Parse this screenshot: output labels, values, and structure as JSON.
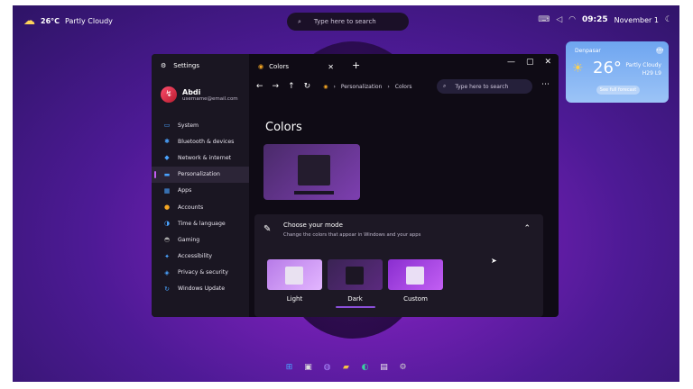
{
  "topbar": {
    "weather_temp": "26°C",
    "weather_desc": "Partly Cloudy",
    "search_placeholder": "Type here to search",
    "time": "09:25",
    "date": "November 1"
  },
  "weather_widget": {
    "location": "Denpasar",
    "temperature": "26°",
    "condition": "Partly Cloudy",
    "hi_lo": "H29 L9",
    "forecast_link": "See full forecast"
  },
  "settings": {
    "title": "Settings",
    "user_name": "Abdi",
    "user_email": "username@email.com",
    "nav": [
      {
        "label": "System",
        "icon": "▭"
      },
      {
        "label": "Bluetooth & devices",
        "icon": "✱"
      },
      {
        "label": "Network & internet",
        "icon": "◆"
      },
      {
        "label": "Personalization",
        "icon": "▬"
      },
      {
        "label": "Apps",
        "icon": "▦"
      },
      {
        "label": "Accounts",
        "icon": "●"
      },
      {
        "label": "Time & language",
        "icon": "◑"
      },
      {
        "label": "Gaming",
        "icon": "◓"
      },
      {
        "label": "Accessibility",
        "icon": "✦"
      },
      {
        "label": "Privacy & security",
        "icon": "◈"
      },
      {
        "label": "Windows Update",
        "icon": "↻"
      }
    ],
    "active_nav": "Personalization"
  },
  "browser": {
    "tab_title": "Colors",
    "breadcrumb": [
      "Personalization",
      "Colors"
    ],
    "search_placeholder": "Type here to search"
  },
  "page": {
    "title": "Colors",
    "mode_title": "Choose your mode",
    "mode_subtitle": "Change the colors that appear in Windows and your apps",
    "modes": [
      "Light",
      "Dark",
      "Custom"
    ],
    "selected_mode": "Dark"
  }
}
